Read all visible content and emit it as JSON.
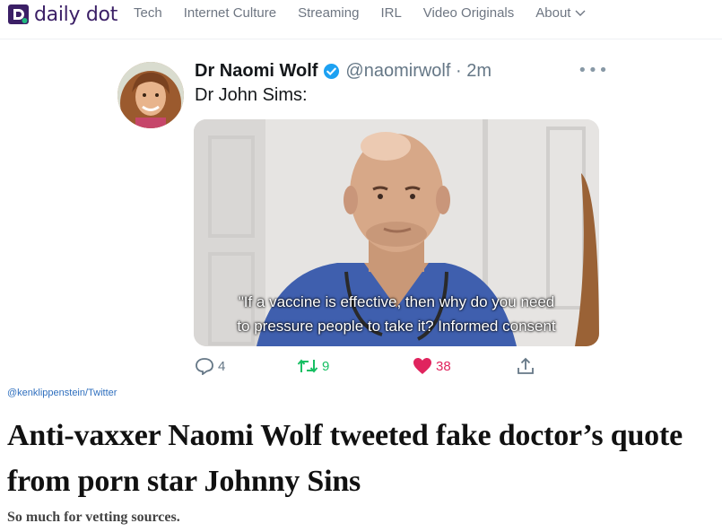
{
  "site": {
    "logo_text": "daily dot",
    "brand_color": "#3b1f66",
    "accent_color": "#1fb97e"
  },
  "nav": {
    "items": [
      {
        "label": "Tech"
      },
      {
        "label": "Internet Culture"
      },
      {
        "label": "Streaming"
      },
      {
        "label": "IRL"
      },
      {
        "label": "Video Originals"
      },
      {
        "label": "About"
      }
    ]
  },
  "tweet": {
    "display_name": "Dr Naomi Wolf",
    "handle_time": "@naomirwolf · 2m",
    "text": "Dr John Sims:",
    "caption_line1": "\"If a vaccine is effective, then why do you need",
    "caption_line2": "to pressure people to take it? Informed consent",
    "replies": "4",
    "retweets": "9",
    "likes": "38",
    "more_icon": "ellipsis-icon",
    "verified_color": "#1da1f2",
    "like_color": "#e0245e",
    "retweet_color": "#17bf63"
  },
  "article": {
    "credit": "@kenklippenstein/Twitter",
    "headline_line1": "Anti-vaxxer Naomi Wolf tweeted fake doctor’s quote",
    "headline_line2": "from porn star  Johnny Sins",
    "dek": "So much for vetting sources."
  }
}
